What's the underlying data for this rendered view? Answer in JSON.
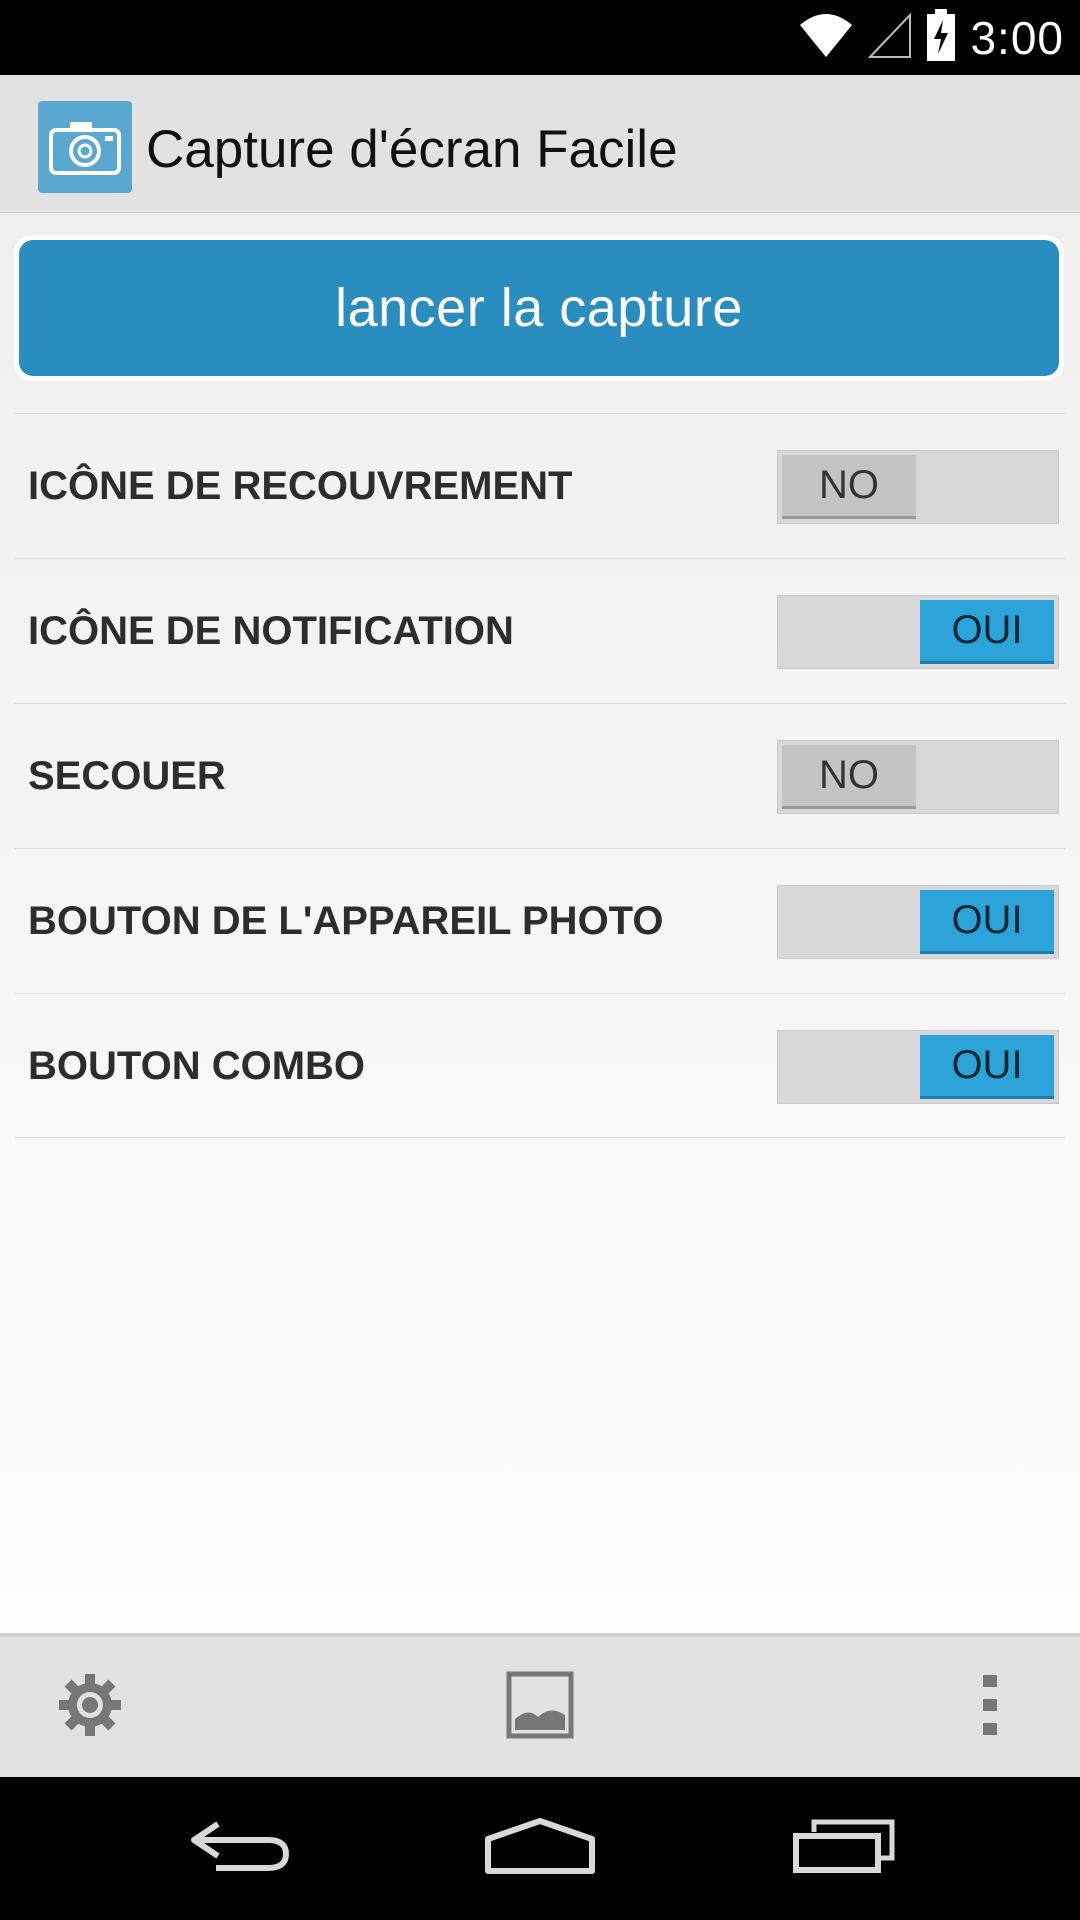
{
  "status_bar": {
    "time": "3:00",
    "icons": [
      "wifi-icon",
      "signal-icon",
      "battery-charging-icon"
    ]
  },
  "action_bar": {
    "title": "Capture d'écran Facile",
    "icon": "camera-icon",
    "icon_color": "#5aa7d0"
  },
  "launch_button": {
    "label": "lancer la capture",
    "color": "#2a8dc0"
  },
  "settings": [
    {
      "label": "ICÔNE DE RECOUVREMENT",
      "state": "off",
      "toggle_text": "NO"
    },
    {
      "label": "ICÔNE DE NOTIFICATION",
      "state": "on",
      "toggle_text": "OUI"
    },
    {
      "label": "SECOUER",
      "state": "off",
      "toggle_text": "NO"
    },
    {
      "label": "BOUTON DE L'APPAREIL PHOTO",
      "state": "on",
      "toggle_text": "OUI"
    },
    {
      "label": "BOUTON COMBO",
      "state": "on",
      "toggle_text": "OUI"
    }
  ],
  "bottom_bar": {
    "items": [
      "gear-icon",
      "gallery-icon",
      "overflow-menu-icon"
    ]
  },
  "nav_bar": {
    "items": [
      "back-icon",
      "home-icon",
      "recents-icon"
    ]
  },
  "colors": {
    "toggle_on": "#2ba3d9",
    "toggle_off": "#c4c4c4"
  }
}
